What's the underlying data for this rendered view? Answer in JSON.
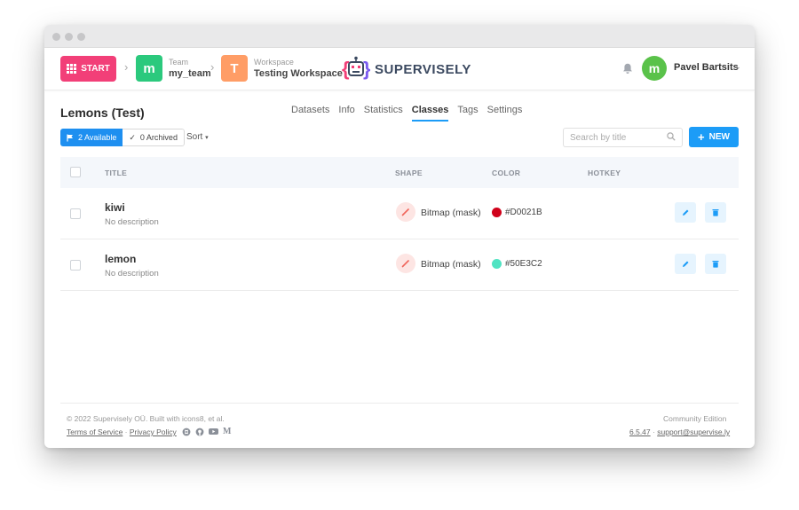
{
  "topbar": {
    "start_label": "START",
    "team": {
      "label": "Team",
      "value": "my_team",
      "avatar_letter": "m",
      "color": "#2bc97d"
    },
    "workspace": {
      "label": "Workspace",
      "value": "Testing Workspace",
      "avatar_letter": "T",
      "color": "#ff9d66"
    },
    "logo_text": "SUPERVISELY",
    "user": {
      "avatar_letter": "m",
      "name": "Pavel Bartsits"
    }
  },
  "page": {
    "title": "Lemons (Test)",
    "tabs": [
      {
        "label": "Datasets",
        "active": false
      },
      {
        "label": "Info",
        "active": false
      },
      {
        "label": "Statistics",
        "active": false
      },
      {
        "label": "Classes",
        "active": true
      },
      {
        "label": "Tags",
        "active": false
      },
      {
        "label": "Settings",
        "active": false
      }
    ],
    "filter_available": "2 Available",
    "filter_archived": "0 Archived",
    "sort_label": "Sort",
    "search_placeholder": "Search by title",
    "new_label": "NEW"
  },
  "table": {
    "headers": {
      "title": "TITLE",
      "shape": "SHAPE",
      "color": "COLOR",
      "hotkey": "HOTKEY"
    },
    "rows": [
      {
        "name": "kiwi",
        "description": "No description",
        "shape": "Bitmap (mask)",
        "color_label": "#D0021B",
        "color": "#D0021B",
        "hotkey": ""
      },
      {
        "name": "lemon",
        "description": "No description",
        "shape": "Bitmap (mask)",
        "color_label": "#50E3C2",
        "color": "#50E3C2",
        "hotkey": ""
      }
    ]
  },
  "footer": {
    "copyright": "© 2022 Supervisely OÜ. Built with icons8, et al.",
    "terms": "Terms of Service",
    "privacy": "Privacy Policy",
    "edition": "Community Edition",
    "version": "6.5.47",
    "support": "support@supervise.ly",
    "social_icons": [
      "slack-icon",
      "github-icon",
      "youtube-icon",
      "medium-icon"
    ]
  },
  "colors": {
    "accent": "#1c9cf7",
    "start": "#f23f78",
    "user_avatar": "#5ac24a"
  }
}
